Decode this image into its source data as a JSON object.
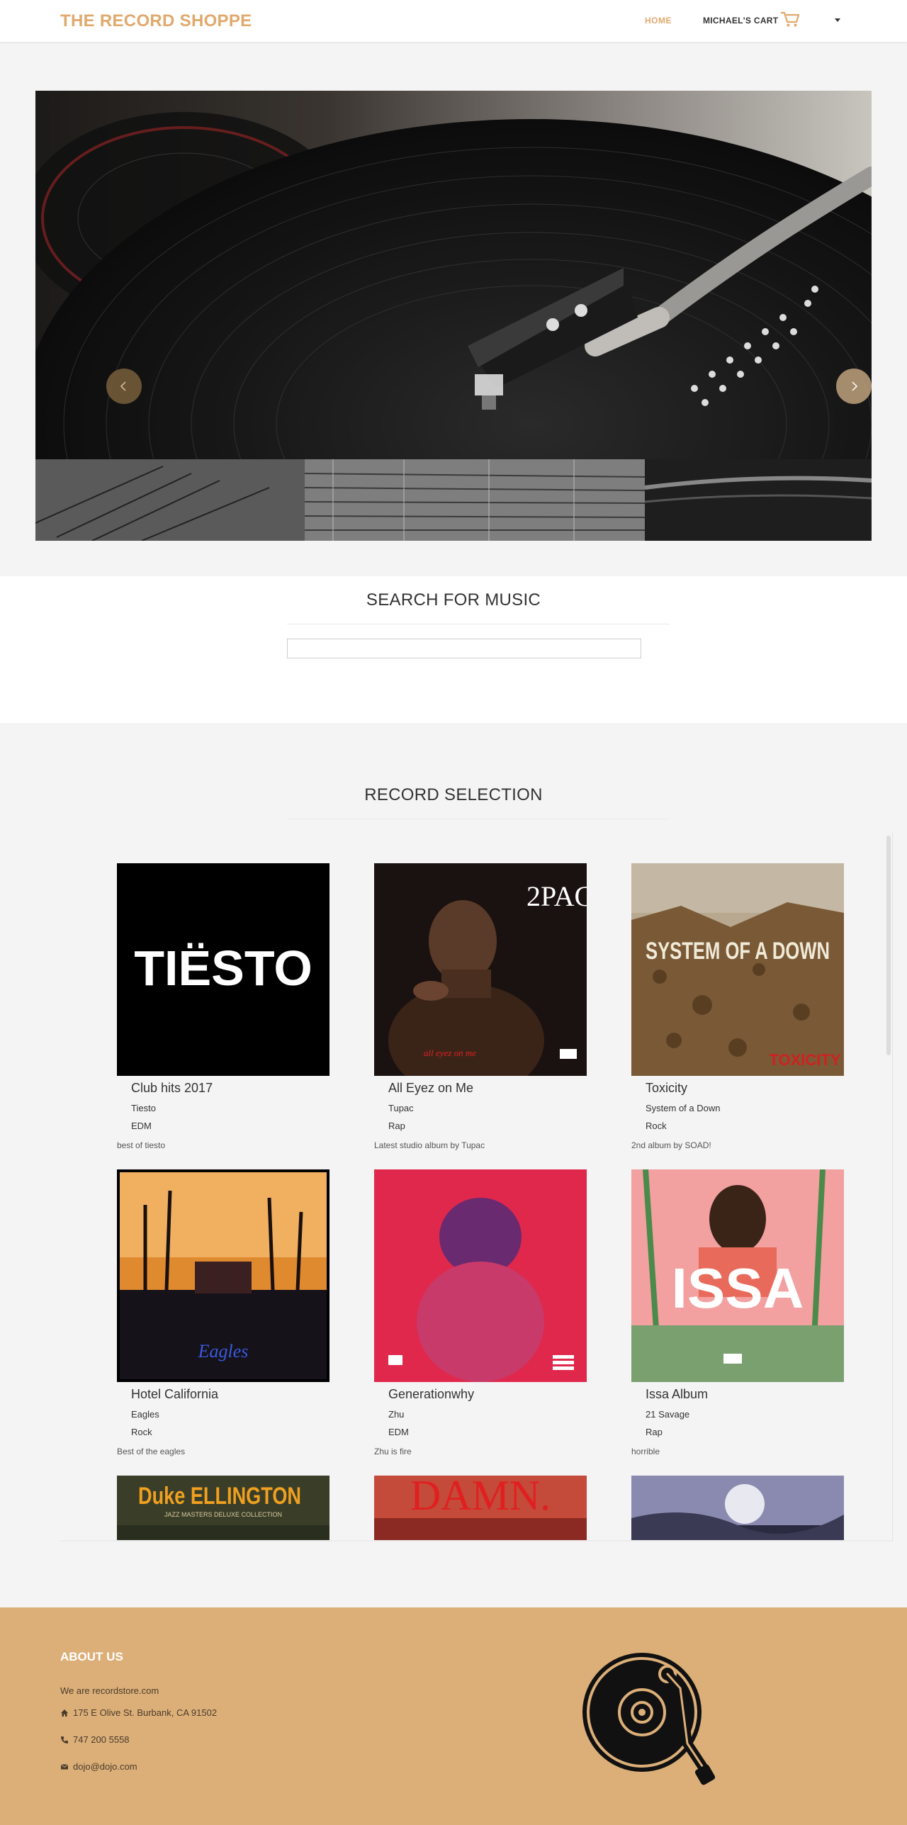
{
  "nav": {
    "brand": "THE RECORD SHOPPE",
    "home_label": "HOME",
    "cart_label": "MICHAEL'S CART",
    "accent": "#e0a96d"
  },
  "hero": {
    "icons": [
      "chevron-left-icon",
      "chevron-right-icon"
    ]
  },
  "search": {
    "title": "SEARCH FOR MUSIC",
    "value": "",
    "placeholder": ""
  },
  "records": {
    "title": "RECORD SELECTION",
    "items": [
      {
        "title": "Club hits 2017",
        "artist": "Tiesto",
        "genre": "EDM",
        "description": "best of tiesto",
        "cover_text": "TIËSTO"
      },
      {
        "title": "All Eyez on Me",
        "artist": "Tupac",
        "genre": "Rap",
        "description": "Latest studio album by Tupac",
        "cover_text": "2PAC",
        "cover_subtext": "all eyez on me"
      },
      {
        "title": "Toxicity",
        "artist": "System of a Down",
        "genre": "Rock",
        "description": "2nd album by SOAD!",
        "cover_text": "SYSTEM OF A DOWN",
        "cover_subtext": "TOXICITY"
      },
      {
        "title": "Hotel California",
        "artist": "Eagles",
        "genre": "Rock",
        "description": "Best of the eagles",
        "cover_text": "Eagles"
      },
      {
        "title": "Generationwhy",
        "artist": "Zhu",
        "genre": "EDM",
        "description": "Zhu is fire"
      },
      {
        "title": "Issa Album",
        "artist": "21 Savage",
        "genre": "Rap",
        "description": "horrible",
        "cover_text": "ISSA"
      },
      {
        "title": "",
        "artist": "",
        "genre": "",
        "description": "",
        "cover_text": "Duke ELLINGTON",
        "cover_subtext": "JAZZ MASTERS DELUXE COLLECTION"
      },
      {
        "title": "",
        "artist": "",
        "genre": "",
        "description": "",
        "cover_text": "DAMN."
      },
      {
        "title": "",
        "artist": "",
        "genre": "",
        "description": ""
      }
    ]
  },
  "footer": {
    "title": "ABOUT US",
    "tagline": "We are recordstore.com",
    "address": "175 E Olive St. Burbank, CA 91502",
    "phone": "747 200 5558",
    "email": "dojo@dojo.com",
    "background": "#dcaf79"
  }
}
